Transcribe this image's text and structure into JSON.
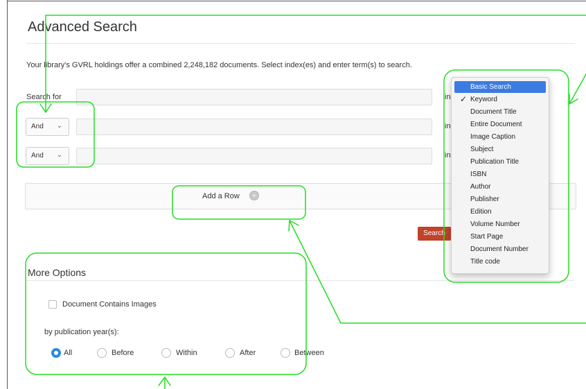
{
  "page": {
    "title": "Advanced Search",
    "intro": "Your library's GVRL holdings offer a combined   2,248,182  documents. Select index(es) and enter term(s) to search."
  },
  "search_rows": [
    {
      "label": "Search for",
      "value": "",
      "in_label": "in"
    },
    {
      "operator": "And",
      "value": "",
      "in_label": "in"
    },
    {
      "operator": "And",
      "value": "",
      "in_label": "in"
    }
  ],
  "add_row": {
    "label": "Add a Row",
    "icon": "plus-circle-icon"
  },
  "search_button": {
    "label": "Search"
  },
  "more_options": {
    "title": "More Options",
    "contains_images_label": "Document Contains Images",
    "contains_images_checked": false,
    "pubyear_label": "by publication year(s):",
    "pubyear_options": [
      "All",
      "Before",
      "Within",
      "After",
      "Between"
    ],
    "pubyear_selected": "All"
  },
  "index_dropdown": {
    "items": [
      "Basic Search",
      "Keyword",
      "Document Title",
      "Entire Document",
      "Image Caption",
      "Subject",
      "Publication Title",
      "ISBN",
      "Author",
      "Publisher",
      "Edition",
      "Volume Number",
      "Start Page",
      "Document Number",
      "Title code"
    ],
    "highlighted": "Basic Search",
    "checked": "Keyword"
  },
  "colors": {
    "annotation": "#22dd22",
    "search_button": "#c0432a",
    "dropdown_highlight": "#3b7be2",
    "radio_accent": "#2b8ad8"
  }
}
